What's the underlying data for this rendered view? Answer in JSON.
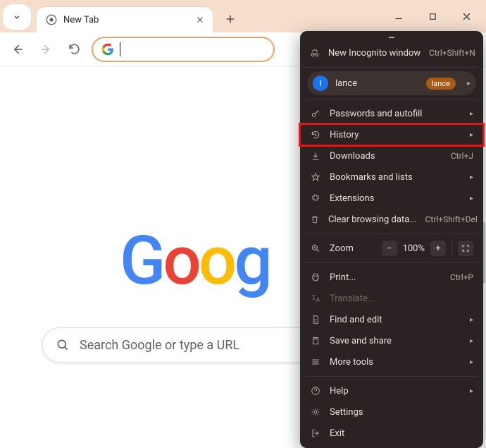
{
  "tab": {
    "title": "New Tab"
  },
  "omnibox": {
    "value": ""
  },
  "page": {
    "logo_letters": [
      "G",
      "o",
      "o",
      "g"
    ],
    "search_placeholder": "Search Google or type a URL"
  },
  "profile": {
    "initial": "I",
    "name": "lance",
    "badge": "lance"
  },
  "menu": {
    "new_incognito": {
      "label": "New Incognito window",
      "accel": "Ctrl+Shift+N"
    },
    "passwords": {
      "label": "Passwords and autofill"
    },
    "history": {
      "label": "History"
    },
    "downloads": {
      "label": "Downloads",
      "accel": "Ctrl+J"
    },
    "bookmarks": {
      "label": "Bookmarks and lists"
    },
    "extensions": {
      "label": "Extensions"
    },
    "clear": {
      "label": "Clear browsing data...",
      "accel": "Ctrl+Shift+Del"
    },
    "zoom": {
      "label": "Zoom",
      "value": "100%"
    },
    "print": {
      "label": "Print...",
      "accel": "Ctrl+P"
    },
    "translate": {
      "label": "Translate..."
    },
    "find": {
      "label": "Find and edit"
    },
    "save_share": {
      "label": "Save and share"
    },
    "more_tools": {
      "label": "More tools"
    },
    "help": {
      "label": "Help"
    },
    "settings": {
      "label": "Settings"
    },
    "exit": {
      "label": "Exit"
    }
  }
}
